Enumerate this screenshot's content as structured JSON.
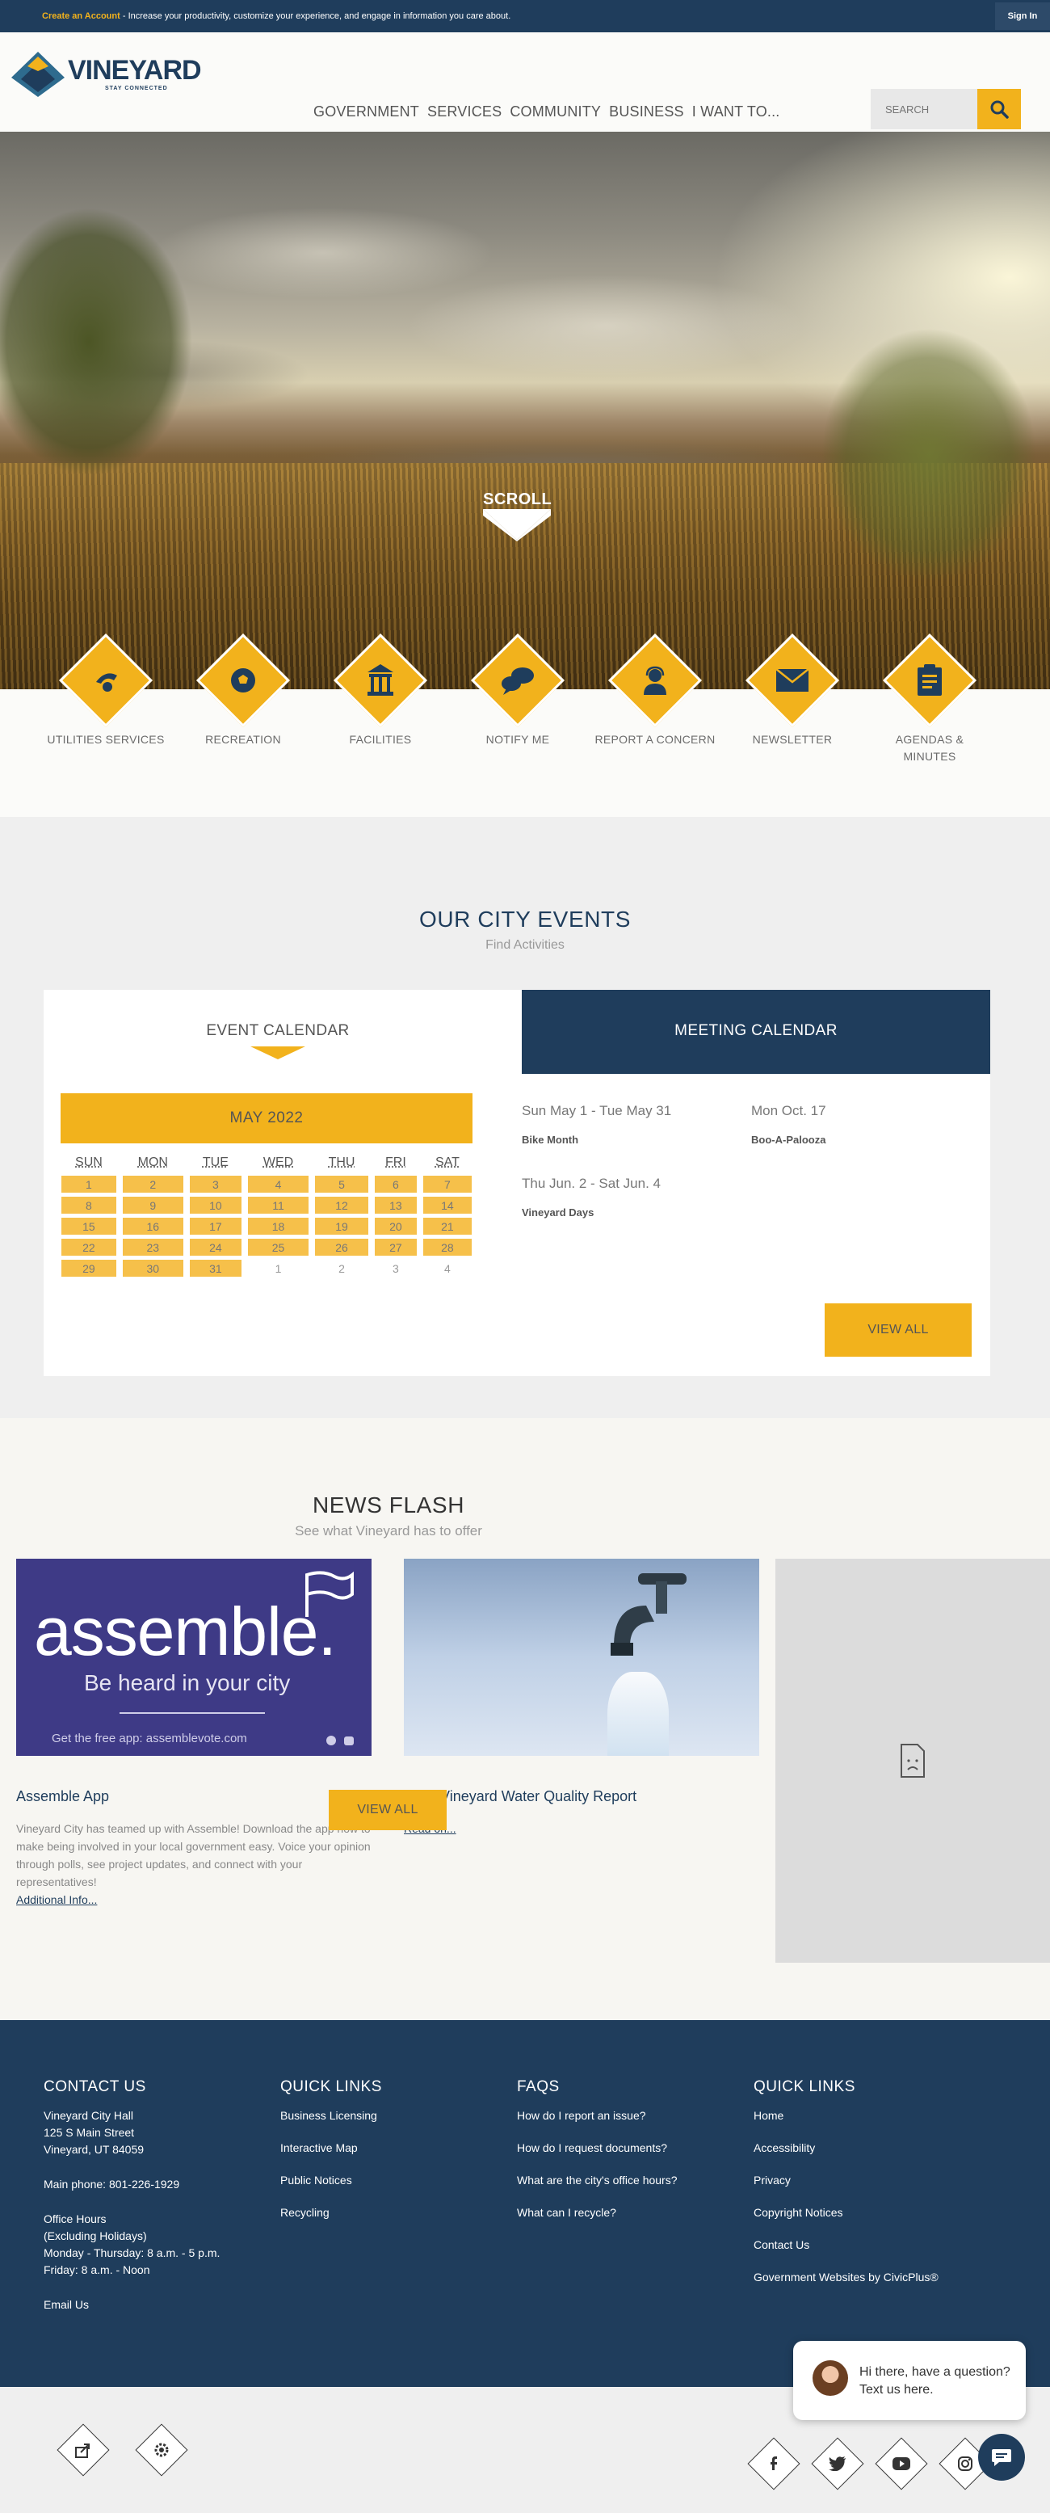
{
  "topbar": {
    "create_link": "Create an Account",
    "message": " - Increase your productivity, customize your experience, and engage in information you care about.",
    "sign_in": "Sign In"
  },
  "header": {
    "logo_name": "VINEYARD",
    "logo_tagline": "STAY CONNECTED",
    "nav": [
      "GOVERNMENT",
      "SERVICES",
      "COMMUNITY",
      "BUSINESS",
      "I WANT TO..."
    ],
    "search_placeholder": "SEARCH"
  },
  "hero": {
    "scroll_label": "SCROLL"
  },
  "quick_links": [
    {
      "label": "UTILITIES SERVICES",
      "icon": "water-drop-icon"
    },
    {
      "label": "RECREATION",
      "icon": "soccer-ball-icon"
    },
    {
      "label": "FACILITIES",
      "icon": "gazebo-icon"
    },
    {
      "label": "NOTIFY ME",
      "icon": "chat-bubbles-icon"
    },
    {
      "label": "REPORT A CONCERN",
      "icon": "headset-person-icon"
    },
    {
      "label": "NEWSLETTER",
      "icon": "envelope-icon"
    },
    {
      "label": "AGENDAS & MINUTES",
      "icon": "clipboard-icon"
    }
  ],
  "events": {
    "title": "OUR CITY EVENTS",
    "subtitle": "Find Activities",
    "tab_event": "EVENT CALENDAR",
    "tab_meeting": "MEETING CALENDAR",
    "month": "MAY 2022",
    "weekdays": [
      "SUN",
      "MON",
      "TUE",
      "WED",
      "THU",
      "FRI",
      "SAT"
    ],
    "weeks": [
      [
        "1",
        "2",
        "3",
        "4",
        "5",
        "6",
        "7"
      ],
      [
        "8",
        "9",
        "10",
        "11",
        "12",
        "13",
        "14"
      ],
      [
        "15",
        "16",
        "17",
        "18",
        "19",
        "20",
        "21"
      ],
      [
        "22",
        "23",
        "24",
        "25",
        "26",
        "27",
        "28"
      ],
      [
        "29",
        "30",
        "31",
        "1",
        "2",
        "3",
        "4"
      ]
    ],
    "meetings": [
      {
        "date": "Sun May 1 - Tue May 31",
        "title": "Bike Month"
      },
      {
        "date": "Mon Oct. 17",
        "title": "Boo-A-Palooza"
      },
      {
        "date": "Thu Jun. 2 - Sat Jun. 4",
        "title": "Vineyard Days"
      }
    ],
    "view_all": "VIEW ALL"
  },
  "news": {
    "title": "NEWS FLASH",
    "subtitle": "See what Vineyard has to offer",
    "cards": [
      {
        "title": "Assemble App",
        "text": "Vineyard City has teamed up with Assemble! Download the app now to make being involved in your local government easy. Voice your opinion through polls, see project updates, and connect with your representatives!",
        "link": "Additional Info...",
        "img_word": "assemble.",
        "img_slogan": "Be heard in your city",
        "img_app": "Get the free app:   assemblevote.com"
      },
      {
        "title": "2020 Vineyard Water Quality Report",
        "link": "Read on..."
      }
    ],
    "view_all": "VIEW ALL"
  },
  "footer": {
    "contact": {
      "heading": "CONTACT US",
      "lines": [
        "Vineyard City Hall",
        "125 S Main Street",
        "Vineyard, UT 84059"
      ],
      "phone": "Main phone: 801-226-1929",
      "hours": [
        "Office Hours",
        "(Excluding Holidays)",
        "Monday - Thursday: 8 a.m. - 5 p.m.",
        "Friday: 8 a.m. - Noon"
      ],
      "email": "Email Us"
    },
    "quick_links_1": {
      "heading": "QUICK LINKS",
      "links": [
        "Business Licensing",
        "Interactive Map",
        "Public Notices",
        "Recycling"
      ]
    },
    "faqs": {
      "heading": "FAQS",
      "links": [
        "How do I report an issue?",
        "How do I request documents?",
        "What are the city's office hours?",
        "What can I recycle?"
      ]
    },
    "quick_links_2": {
      "heading": "QUICK LINKS",
      "links": [
        "Home",
        "Accessibility",
        "Privacy",
        "Copyright Notices",
        "Contact Us",
        "Government Websites by CivicPlus®"
      ]
    }
  },
  "chat": {
    "message": "Hi there, have a question? Text us here."
  },
  "colors": {
    "navy": "#1f3d5c",
    "gold": "#f2b21c",
    "light_gold": "#f6c04a"
  }
}
